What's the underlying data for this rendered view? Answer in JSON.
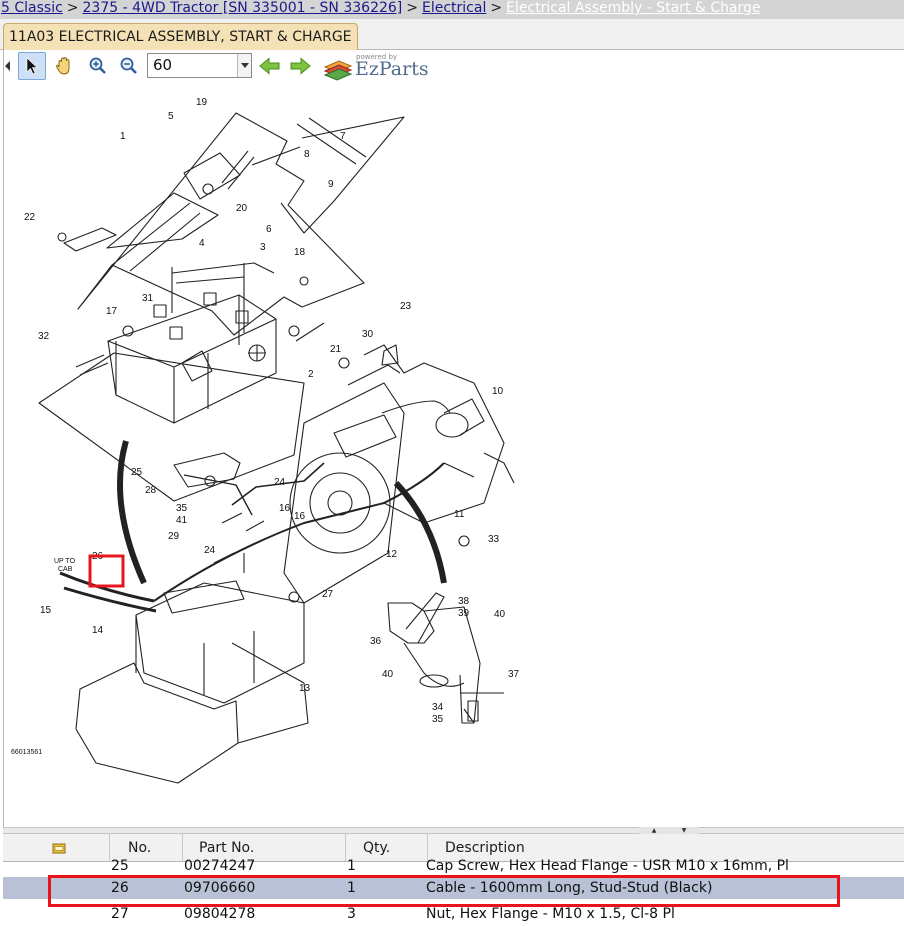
{
  "breadcrumb": {
    "items": [
      "5 Classic",
      "2375 - 4WD Tractor [SN 335001 - SN 336226]",
      "Electrical",
      "Electrical Assembly - Start & Charge"
    ],
    "separator": ">"
  },
  "tab": {
    "label": "11A03 ELECTRICAL ASSEMBLY, START & CHARGE"
  },
  "toolbar": {
    "tools": [
      "pointer-icon",
      "hand-pan-icon",
      "zoom-in-icon",
      "zoom-out-icon"
    ],
    "zoom_value": "60",
    "nav": [
      "arrow-left-icon",
      "arrow-right-icon"
    ],
    "brand_powered": "powered by",
    "brand_name": "EzParts"
  },
  "diagram": {
    "figure_code": "66013561",
    "up_to_cab_line1": "UP TO",
    "up_to_cab_line2": "CAB",
    "highlighted_callout": "26",
    "callouts": [
      "1",
      "2",
      "3",
      "4",
      "5",
      "6",
      "7",
      "8",
      "9",
      "10",
      "11",
      "12",
      "13",
      "14",
      "15",
      "16",
      "17",
      "18",
      "19",
      "20",
      "21",
      "22",
      "23",
      "24",
      "25",
      "26",
      "27",
      "28",
      "29",
      "30",
      "31",
      "32",
      "33",
      "34",
      "35",
      "36",
      "37",
      "38",
      "39",
      "40",
      "41"
    ]
  },
  "table": {
    "columns": [
      "",
      "No.",
      "Part No.",
      "Qty.",
      "Description"
    ],
    "header_icon": "folder-note-icon",
    "rows": [
      {
        "no": "25",
        "part": "00274247",
        "qty": "1",
        "desc": "Cap Screw, Hex Head Flange - USR M10 x 16mm, Pl"
      },
      {
        "no": "26",
        "part": "09706660",
        "qty": "1",
        "desc": "Cable - 1600mm Long, Stud-Stud (Black)"
      },
      {
        "no": "27",
        "part": "09804278",
        "qty": "3",
        "desc": "Nut, Hex Flange - M10 x 1.5, Cl-8 Pl"
      }
    ],
    "selected_index": 1
  },
  "colors": {
    "highlight": "#e8141c",
    "selected_row": "#b8c1d6",
    "tab_bg": "#f4e1b5",
    "link": "#1a1a8c"
  }
}
